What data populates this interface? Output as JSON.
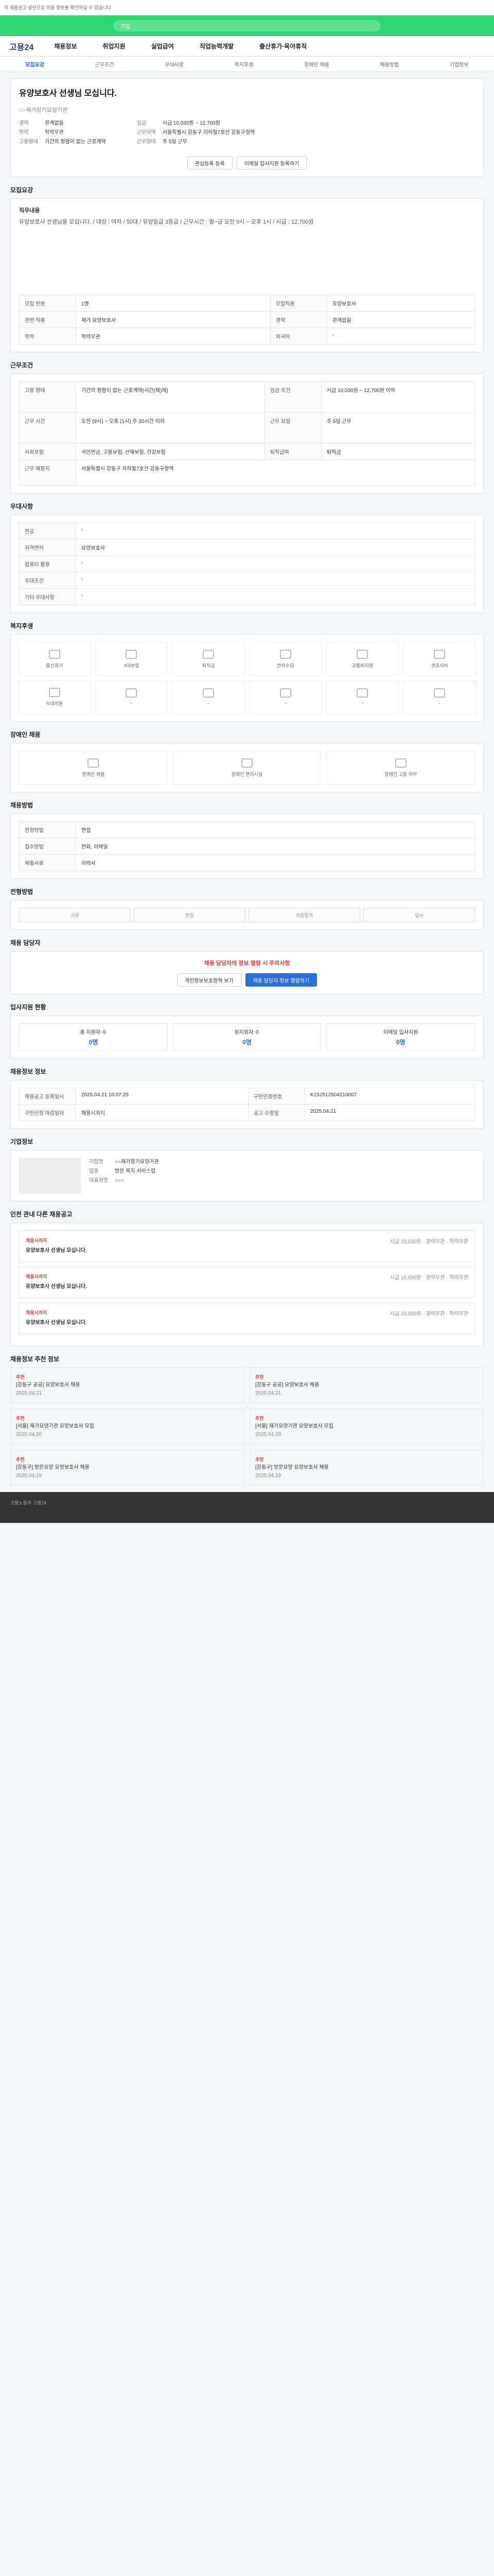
{
  "page": {
    "top_notice": "이 채용공고 상단으로 이동 정보를 확인하실 수 있습니다",
    "banner_text": "가입",
    "logo": "고용24",
    "gnb": [
      "채용정보",
      "취업지원",
      "실업급여",
      "직업능력개발",
      "출산휴가·육아휴직"
    ],
    "tabs": [
      "모집요강",
      "근무조건",
      "우대사항",
      "복지후생",
      "장애인 채용",
      "채용방법",
      "기업정보"
    ],
    "title": "유양보호사 선생님 모십니다.",
    "company_name": "○○재가장기요양기관",
    "summary_left": [
      {
        "k": "경력",
        "v": "관계없음"
      },
      {
        "k": "학력",
        "v": "학력무관"
      },
      {
        "k": "고용형태",
        "v": "기간의 정함이 없는 근로계약"
      }
    ],
    "summary_right": [
      {
        "k": "임금",
        "v": "시급 10,030원 ~ 12,700원"
      },
      {
        "k": "근무지역",
        "v": "서울특별시 강동구 지하철7호선 강동구청역"
      },
      {
        "k": "근무형태",
        "v": "주 5일 근무"
      }
    ],
    "btn_fav": "관심등록 등록",
    "btn_apply": "이메일 입사지원 등록하기",
    "sec_recruit": "모집요강",
    "job_desc_title": "직무내용",
    "job_desc": "유양보호사 선생님을 모십니다. / 대상 : 여자 / 50대 / 유양등급 3등급 / 근무시간 : 월~금 오전 9시 ~ 오후 1시 / 시급 : 12,700원",
    "recruit_rows": [
      {
        "k": "모집 인원",
        "v": "1명",
        "k2": "모집직종",
        "v2": "요양보호사"
      },
      {
        "k": "관련 직종",
        "v": "재가 요양보호사",
        "k2": "경력",
        "v2": "관계없음"
      },
      {
        "k": "학력",
        "v": "학력무관",
        "k2": "외국어",
        "v2": "-"
      }
    ],
    "sec_work": "근무조건",
    "work_rows": [
      {
        "k": "고용 형태",
        "v": "기간의 정함이 없는 근로계약(시간(제)제)",
        "k2": "임금 조건",
        "v2": "시급 10,030원 ~ 12,700원 이하"
      },
      {
        "k": "근무 시간",
        "v": "오전 (9시) ~ 오후 (1시) 주 20시간 이하",
        "k2": "근무 요일",
        "v2": "주 5일 근무"
      },
      {
        "k": "사회보험",
        "v": "국민연금, 고용보험, 산재보험, 건강보험",
        "k2": "퇴직급여",
        "v2": "퇴직금"
      },
      {
        "k": "근무 예정지",
        "v": "서울특별시 강동구 지하철7호선 강동구청역",
        "k2": "",
        "v2": ""
      }
    ],
    "sec_pref": "우대사항",
    "pref_rows": [
      {
        "k": "전공",
        "v": "-"
      },
      {
        "k": "자격면허",
        "v": "요양보호사"
      },
      {
        "k": "컴퓨터 활용",
        "v": "-"
      },
      {
        "k": "우대조건",
        "v": "-"
      },
      {
        "k": "기타 우대사항",
        "v": "-"
      }
    ],
    "sec_welfare": "복지후생",
    "welfare": [
      "출산휴가",
      "4대보험",
      "퇴직금",
      "연차수당",
      "교통비지원",
      "경조사비",
      "식대지원",
      "-",
      "-",
      "-",
      "-",
      "-"
    ],
    "sec_disabled": "장애인 채용",
    "disabled": [
      "장애인 채용",
      "장애인 편의시설",
      "장애인 고용 의무"
    ],
    "sec_method": "채용방법",
    "method_rows": [
      {
        "k": "전형방법",
        "v": "면접"
      },
      {
        "k": "접수방법",
        "v": "전화, 이메일"
      },
      {
        "k": "제출서류",
        "v": "이력서"
      }
    ],
    "sec_progress": "전형방법",
    "progress": [
      "서류",
      "면접",
      "최종합격",
      "입사"
    ],
    "sec_contact": "채용 담당자",
    "contact_alert": "채용 담당자의 정보 열람 시 주의사항",
    "contact_btn1": "개인정보보호정책 보기",
    "contact_btn2": "채용 담당자 정보 열람하기",
    "sec_apply": "입사지원 현황",
    "apply_stats": [
      {
        "label": "총 지원자 수",
        "value": "0명"
      },
      {
        "label": "원지원자 수",
        "value": "0명"
      },
      {
        "label": "이메일 입사지원",
        "value": "0명"
      }
    ],
    "sec_info": "채용정보 정보",
    "info_rows": [
      {
        "k": "채용공고 등록일시",
        "v": "2025.04.21 10:07:26",
        "k2": "구인인증번호",
        "v2": "K152512504210007"
      },
      {
        "k": "구인신청 마감일자",
        "v": "채용시까지",
        "k2": "공고 수정일",
        "v2": "2025.04.21"
      }
    ],
    "sec_company": "기업정보",
    "company_rows": [
      {
        "k": "기업명",
        "v": "○○재가장기요양기관"
      },
      {
        "k": "업종",
        "v": "방문 복지 서비스업"
      },
      {
        "k": "대표자명",
        "v": "○○○"
      }
    ],
    "sec_other": "인천 관내 다른 채용공고",
    "other_jobs": [
      {
        "label": "채용시까지",
        "title": "유양보호사 선생님 모십니다.",
        "detail": "시급 10,030원 · 경력무관 · 학력무관"
      },
      {
        "label": "채용시까지",
        "title": "유양보호사 선생님 모십니다.",
        "detail": "시급 10,030원 · 경력무관 · 학력무관"
      },
      {
        "label": "채용시까지",
        "title": "유양보호사 선생님 모십니다.",
        "detail": "시급 10,030원 · 경력무관 · 학력무관"
      }
    ],
    "sec_news": "채용정보 추천 정보",
    "news": [
      {
        "tag": "추천",
        "title": "[강동구 공공] 요양보호사 채용",
        "date": "2025.04.21"
      },
      {
        "tag": "추천",
        "title": "[강동구 공공] 요양보호사 채용",
        "date": "2025.04.21"
      },
      {
        "tag": "추천",
        "title": "[서울] 재가요양기관 요양보호사 모집",
        "date": "2025.04.20"
      },
      {
        "tag": "추천",
        "title": "[서울] 재가요양기관 요양보호사 모집",
        "date": "2025.04.20"
      },
      {
        "tag": "추천",
        "title": "[강동구] 방문요양 요양보호사 채용",
        "date": "2025.04.19"
      },
      {
        "tag": "추천",
        "title": "[강동구] 방문요양 요양보호사 채용",
        "date": "2025.04.19"
      }
    ],
    "footer": "고용노동부 고용24"
  }
}
